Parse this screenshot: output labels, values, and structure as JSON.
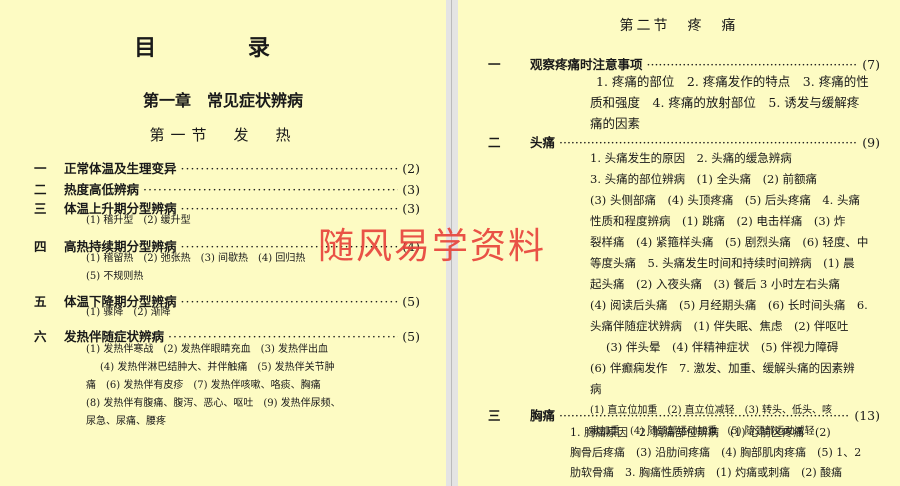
{
  "left": {
    "title": "目 录",
    "chapter": "第一章　常见症状辨病",
    "section": "第一节　发　热",
    "entries": [
      {
        "num": "一",
        "label": "正常体温及生理变异",
        "page": "(2)"
      },
      {
        "num": "二",
        "label": "热度高低辨病",
        "page": "(3)"
      },
      {
        "num": "三",
        "label": "体温上升期分型辨病",
        "page": "(3)"
      },
      {
        "num": "四",
        "label": "高热持续期分型辨病",
        "page": "(4)"
      },
      {
        "num": "五",
        "label": "体温下降期分型辨病",
        "page": "(5)"
      },
      {
        "num": "六",
        "label": "发热伴随症状辨病",
        "page": "(5)"
      }
    ],
    "subs": [
      "(1) 稽升型　(2) 缓升型",
      "(1) 稽留热　(2) 弛张热　(3) 间歇热　(4) 回归热",
      "(5) 不规则热",
      "(1) 骤降　(2) 渐降",
      "(1) 发热伴寒战　(2) 发热伴眼睛充血　(3) 发热伴出血",
      "(4) 发热伴淋巴结肿大、并伴触痛　(5) 发热伴关节肿",
      "痛　(6) 发热伴有皮疹　(7) 发热伴咳嗽、咯痰、胸痛",
      "(8) 发热伴有腹痛、腹泻、恶心、呕吐　(9) 发热伴尿频、",
      "尿急、尿痛、腰疼"
    ]
  },
  "right": {
    "title": "第二节　疼　痛",
    "entries": [
      {
        "num": "一",
        "label": "观察疼痛时注意事项",
        "page": "(7)"
      },
      {
        "num": "二",
        "label": "头痛",
        "page": "(9)"
      },
      {
        "num": "三",
        "label": "胸痛",
        "page": "(13)"
      }
    ],
    "body1": [
      "1. 疼痛的部位　2. 疼痛发作的特点　3. 疼痛的性",
      "质和强度　4. 疼痛的放射部位　5. 诱发与缓解疼",
      "痛的因素"
    ],
    "body2": [
      "1. 头痛发生的原因　2. 头痛的缓急辨病",
      "3. 头痛的部位辨病　(1) 全头痛　(2) 前额痛",
      "(3) 头侧部痛　(4) 头顶疼痛　(5) 后头疼痛　4. 头痛",
      "性质和程度辨病　(1) 跳痛　(2) 电击样痛　(3) 炸",
      "裂样痛　(4) 紧箍样头痛　(5) 剧烈头痛　(6) 轻度、中",
      "等度头痛　5. 头痛发生时间和持续时间辨病　(1) 晨",
      "起头痛　(2) 入夜头痛　(3) 餐后 3 小时左右头痛",
      "(4) 阅读后头痛　(5) 月经期头痛　(6) 长时间头痛　6.",
      "头痛伴随症状辨病　(1) 伴失眠、焦虑　(2) 伴呕吐",
      "(3) 伴头晕　(4) 伴精神症状　(5) 伴视力障碍",
      "(6) 伴癫痫发作　7. 激发、加重、缓解头痛的因素辨",
      "病",
      "(1) 直立位加重　(2) 直立位减轻　(3) 转头、低头、咳",
      "嗽加重　(4) 随颈部运动加重　(5) 随颈部运动减轻"
    ],
    "body3": [
      "1. 胸痛原因　2. 胸痛部位辨病　(1) 心前区疼痛　(2)",
      "胸骨后疼痛　(3) 沿肋间疼痛　(4) 胸部肌肉疼痛　(5) 1、2",
      "肋软骨痛　3. 胸痛性质辨病　(1) 灼痛或刺痛　(2) 酸痛"
    ]
  },
  "watermark": "随风易学资料"
}
